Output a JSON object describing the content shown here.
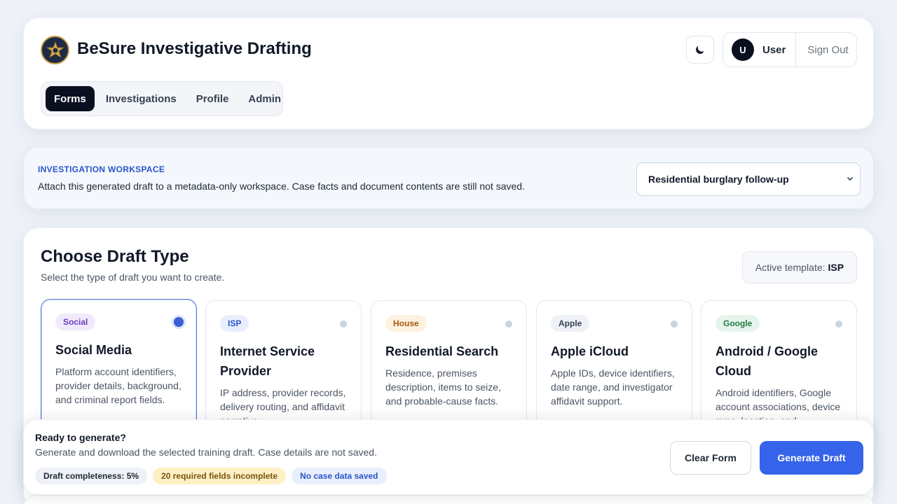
{
  "header": {
    "title": "BeSure Investigative Drafting",
    "logo_icon": "sheriff-badge-icon",
    "nav": [
      {
        "label": "Forms",
        "active": true
      },
      {
        "label": "Investigations",
        "active": false
      },
      {
        "label": "Profile",
        "active": false
      },
      {
        "label": "Admin",
        "active": false
      }
    ],
    "theme_icon": "moon-icon",
    "user": {
      "initial": "U",
      "name": "User",
      "sign_out": "Sign Out"
    }
  },
  "workspace": {
    "eyebrow": "INVESTIGATION WORKSPACE",
    "description": "Attach this generated draft to a metadata-only workspace. Case facts and document contents are still not saved.",
    "selected": "Residential burglary follow-up"
  },
  "draft_type": {
    "title": "Choose Draft Type",
    "subtitle": "Select the type of draft you want to create.",
    "active_template_label": "Active template:",
    "active_template_value": "ISP",
    "templates": [
      {
        "tag": "Social",
        "name": "Social Media",
        "description": "Platform account identifiers, provider details, background, and criminal report fields.",
        "selected": true,
        "tag_bg": "#f1eafd",
        "tag_color": "#6b3fc4"
      },
      {
        "tag": "ISP",
        "name": "Internet Service Provider",
        "description": "IP address, provider records, delivery routing, and affidavit narrative.",
        "selected": false,
        "tag_bg": "#e8eefc",
        "tag_color": "#2b56c9"
      },
      {
        "tag": "House",
        "name": "Residential Search",
        "description": "Residence, premises description, items to seize, and probable-cause facts.",
        "selected": false,
        "tag_bg": "#fdf1e0",
        "tag_color": "#a35a0c"
      },
      {
        "tag": "Apple",
        "name": "Apple iCloud",
        "description": "Apple IDs, device identifiers, date range, and investigator affidavit support.",
        "selected": false,
        "tag_bg": "#eef1f6",
        "tag_color": "#374151"
      },
      {
        "tag": "Google",
        "name": "Android / Google Cloud",
        "description": "Android identifiers, Google account associations, device sync, location, and",
        "selected": false,
        "tag_bg": "#e6f5ec",
        "tag_color": "#1f7a45"
      }
    ]
  },
  "action_bar": {
    "title": "Ready to generate?",
    "description": "Generate and download the selected training draft. Case details are not saved.",
    "chips": {
      "completeness": "Draft completeness: 5%",
      "required": "20 required fields incomplete",
      "saved": "No case data saved"
    },
    "clear_label": "Clear Form",
    "generate_label": "Generate Draft"
  }
}
